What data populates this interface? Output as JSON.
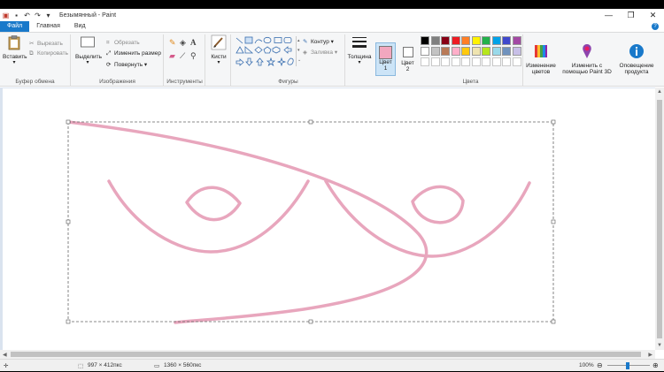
{
  "window": {
    "title": "Безымянный - Paint",
    "controls": [
      "minimize",
      "maximize",
      "close"
    ]
  },
  "tabs": [
    "Файл",
    "Главная",
    "Вид"
  ],
  "ribbon": {
    "clipboard": {
      "paste": "Вставить",
      "cut": "Вырезать",
      "copy": "Копировать",
      "label": "Буфер обмена"
    },
    "image": {
      "select": "Выделить",
      "crop": "Обрезать",
      "resize": "Изменить размер",
      "rotate": "Повернуть",
      "label": "Изображения"
    },
    "tools": {
      "label": "Инструменты"
    },
    "brushes": {
      "label": "Кисти"
    },
    "shapes": {
      "outline": "Контур",
      "fill": "Заливка",
      "label": "Фигуры"
    },
    "size": {
      "label": "Толщина"
    },
    "color1": {
      "line1": "Цвет",
      "line2": "1",
      "value": "#f2a7bf"
    },
    "color2": {
      "line1": "Цвет",
      "line2": "2",
      "value": "#ffffff"
    },
    "colors_label": "Цвета",
    "edit_colors": {
      "line1": "Изменение",
      "line2": "цветов"
    },
    "paint3d": {
      "line1": "Изменить с",
      "line2": "помощью Paint 3D"
    },
    "product_alert": {
      "line1": "Оповещение",
      "line2": "продукта"
    }
  },
  "palette": [
    "#000000",
    "#7f7f7f",
    "#880015",
    "#ed1c24",
    "#ff7f27",
    "#fff200",
    "#22b14c",
    "#00a2e8",
    "#3f48cc",
    "#a349a4",
    "#ffffff",
    "#c3c3c3",
    "#b97a57",
    "#ffaec9",
    "#ffc90e",
    "#efe4b0",
    "#b5e61d",
    "#99d9ea",
    "#7092be",
    "#c8bfe7"
  ],
  "stroke_color": "#e8a6bd",
  "status": {
    "selection_size": "997 × 412пкс",
    "canvas_size": "1360 × 560пкс",
    "zoom": "100%"
  }
}
